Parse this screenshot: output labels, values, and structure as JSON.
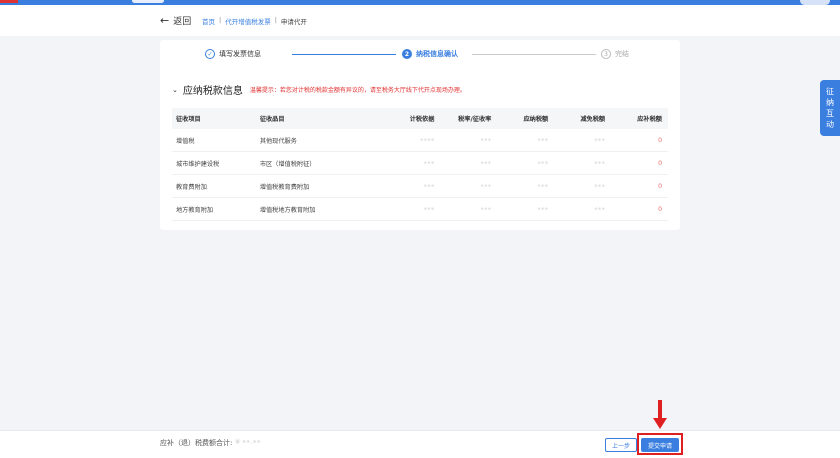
{
  "header": {
    "back_label": "返回",
    "breadcrumb": [
      "首页",
      "代开增值税发票",
      "申请代开"
    ],
    "separators": [
      "|",
      "|"
    ]
  },
  "steps": [
    {
      "num": "✓",
      "label": "填写发票信息",
      "state": "done"
    },
    {
      "num": "2",
      "label": "纳税信息确认",
      "state": "active"
    },
    {
      "num": "3",
      "label": "完结",
      "state": "todo"
    }
  ],
  "section": {
    "title": "应纳税款信息",
    "hint": "温馨提示：若您对计税的税款金额有异议的，请至税务大厅线下代开点现场办理。"
  },
  "table": {
    "headers": [
      "征收项目",
      "征收品目",
      "计税依据",
      "税率/征收率",
      "应纳税额",
      "减免税额",
      "应补税额"
    ],
    "rows": [
      {
        "item": "增值税",
        "category": "其他现代服务",
        "base": "••••",
        "rate": "•••",
        "due": "•••",
        "reduce": "•••",
        "pay": "0"
      },
      {
        "item": "城市维护建设税",
        "category": "市区（增值税附征）",
        "base": "•••",
        "rate": "•••",
        "due": "•••",
        "reduce": "•••",
        "pay": "0"
      },
      {
        "item": "教育费附加",
        "category": "增值税教育费附加",
        "base": "•••",
        "rate": "•••",
        "due": "•••",
        "reduce": "•••",
        "pay": "0"
      },
      {
        "item": "地方教育附加",
        "category": "增值税地方教育附加",
        "base": "•••",
        "rate": "•••",
        "due": "•••",
        "reduce": "•••",
        "pay": "0"
      }
    ]
  },
  "float_tab": [
    "征",
    "纳",
    "互",
    "动"
  ],
  "footer": {
    "total_label": "应补（退）税费额合计:",
    "total_value": "¥ ••.••",
    "prev_label": "上一步",
    "submit_label": "提交申请"
  },
  "colors": {
    "accent": "#3a7fe0",
    "highlight": "#e02020",
    "hint": "#e03030"
  }
}
